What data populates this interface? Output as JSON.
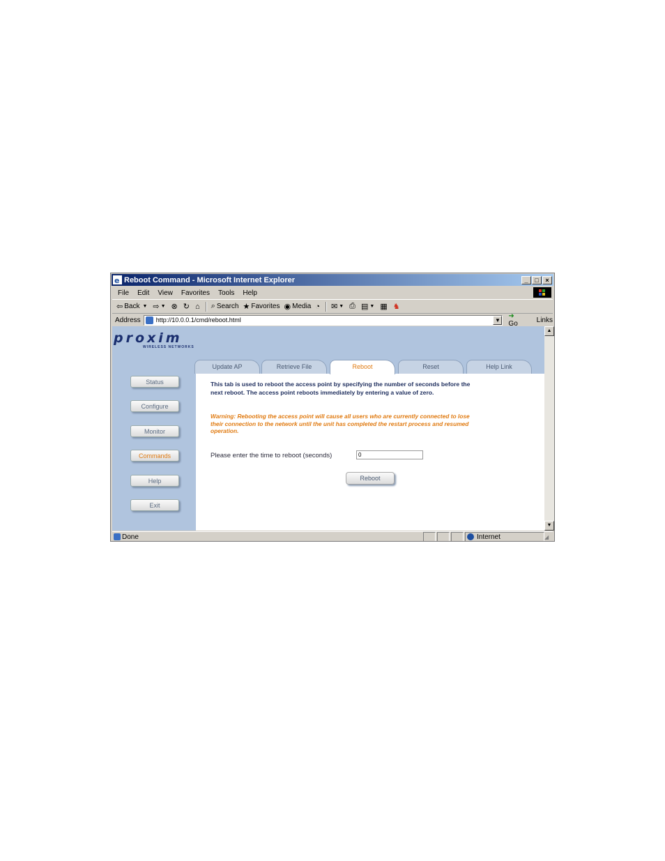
{
  "window": {
    "title": "Reboot Command - Microsoft Internet Explorer",
    "controls": {
      "minimize": "_",
      "maximize": "□",
      "close": "×"
    }
  },
  "menu": [
    "File",
    "Edit",
    "View",
    "Favorites",
    "Tools",
    "Help"
  ],
  "toolbar": {
    "back_label": "Back",
    "search_label": "Search",
    "favorites_label": "Favorites",
    "media_label": "Media"
  },
  "address": {
    "label": "Address",
    "url": "http://10.0.0.1/cmd/reboot.html",
    "go_label": "Go",
    "links_label": "Links"
  },
  "brand": {
    "logo": "proxim",
    "sub": "WIRELESS NETWORKS"
  },
  "sidebar": {
    "items": [
      {
        "label": "Status"
      },
      {
        "label": "Configure"
      },
      {
        "label": "Monitor"
      },
      {
        "label": "Commands",
        "active": true
      },
      {
        "label": "Help"
      },
      {
        "label": "Exit"
      }
    ]
  },
  "tabs": [
    {
      "label": "Update AP"
    },
    {
      "label": "Retrieve File"
    },
    {
      "label": "Reboot",
      "active": true
    },
    {
      "label": "Reset"
    },
    {
      "label": "Help Link"
    }
  ],
  "main": {
    "description": "This tab is used to reboot the access point by specifying the number of seconds before the next reboot. The access point reboots immediately by entering a value of zero.",
    "warning": "Warning: Rebooting the access point will cause all users who are currently connected to lose their connection to the network until the unit has completed the restart process and resumed operation.",
    "prompt": "Please enter the time to reboot (seconds)",
    "reboot_value": "0",
    "reboot_button": "Reboot"
  },
  "status": {
    "text": "Done",
    "zone": "Internet"
  },
  "colors": {
    "accent": "#e07a10",
    "page_bg": "#b0c4de",
    "navy": "#1a2e6e"
  }
}
